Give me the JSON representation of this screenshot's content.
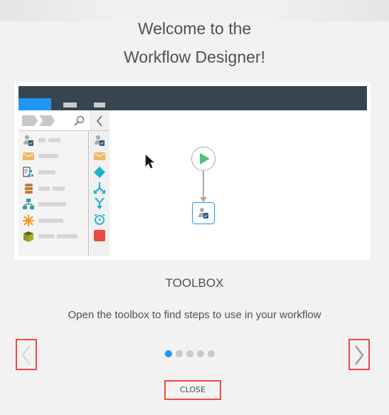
{
  "dialog": {
    "title_line1": "Welcome to the",
    "title_line2": "Workflow Designer!",
    "section_title": "TOOLBOX",
    "description": "Open the toolbox to find steps to use in your workflow",
    "close_label": "CLOSE",
    "prev_icon": "chevron-left-icon",
    "next_icon": "chevron-right-icon"
  },
  "pagination": {
    "total": 5,
    "current": 1
  },
  "preview": {
    "toolbox_items": [
      {
        "icon": "user-task-icon",
        "color": "#2e5c7a"
      },
      {
        "icon": "email-icon",
        "color": "#f0b865"
      },
      {
        "icon": "form-icon",
        "color": "#26a6b8"
      },
      {
        "icon": "database-icon",
        "color": "#c07a2e"
      },
      {
        "icon": "hierarchy-icon",
        "color": "#26a69a"
      },
      {
        "icon": "asterisk-icon",
        "color": "#f7941d"
      },
      {
        "icon": "package-icon",
        "color": "#8a9a2a"
      }
    ],
    "rail_items": [
      {
        "icon": "user-task-icon"
      },
      {
        "icon": "email-icon"
      },
      {
        "icon": "decision-diamond-icon",
        "color": "#1ab0d0"
      },
      {
        "icon": "split-icon",
        "color": "#1ab0d0"
      },
      {
        "icon": "merge-icon",
        "color": "#1ab0d0"
      },
      {
        "icon": "timer-icon",
        "color": "#1ab0d0"
      },
      {
        "icon": "stop-icon",
        "color": "#e84a3c"
      }
    ],
    "colors": {
      "header": "#36454f",
      "accent": "#2196f3",
      "start": "#4cc37a"
    }
  }
}
